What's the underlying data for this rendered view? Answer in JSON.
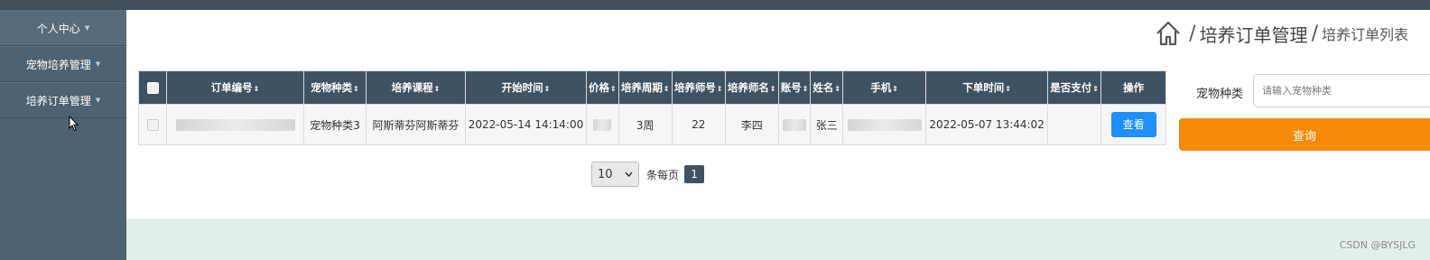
{
  "sidebar": {
    "items": [
      {
        "label": "个人中心"
      },
      {
        "label": "宠物培养管理"
      },
      {
        "label": "培养订单管理"
      }
    ]
  },
  "breadcrumb": {
    "separator": "/",
    "level1": "培养订单管理",
    "level2": "培养订单列表"
  },
  "table": {
    "headers": [
      "订单编号",
      "宠物种类",
      "培养课程",
      "开始时间",
      "价格",
      "培养周期",
      "培养师号",
      "培养师名",
      "账号",
      "姓名",
      "手机",
      "下单时间",
      "是否支付",
      "操作"
    ],
    "sort_glyph": "⇕",
    "rows": [
      {
        "pet_type": "宠物种类3",
        "course": "阿斯蒂芬阿斯蒂芬",
        "start_time": "2022-05-14 14:14:00",
        "period": "3周",
        "trainer_no": "22",
        "trainer_name": "李四",
        "name": "张三",
        "order_time": "2022-05-07 13:44:02",
        "action_label": "查看"
      }
    ]
  },
  "pagination": {
    "page_size": "10",
    "page_size_label": "条每页",
    "current_page": "1"
  },
  "search": {
    "label": "宠物种类",
    "placeholder": "请输入宠物种类",
    "button_label": "查询"
  },
  "watermark": "CSDN @BYSJLG",
  "colors": {
    "sidebar": "#4d6272",
    "header": "#3f5262",
    "accent_button": "#f58a07",
    "view_button": "#1e90ff",
    "footer": "#e3efeb"
  }
}
